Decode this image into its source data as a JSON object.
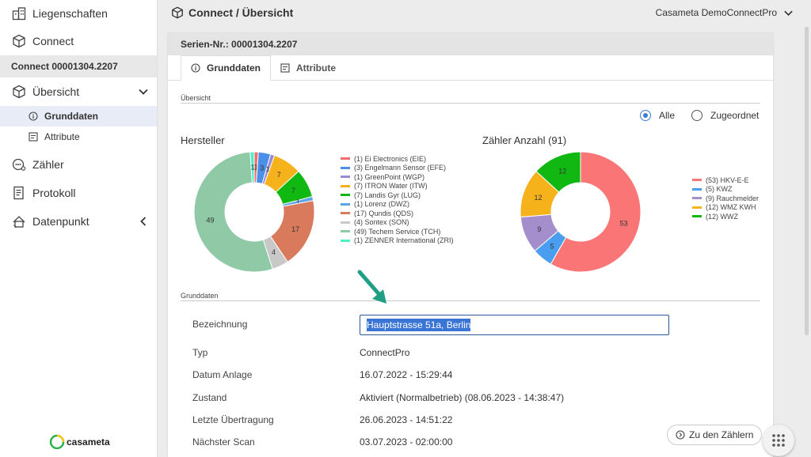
{
  "sidebar": {
    "items": [
      {
        "label": "Liegenschaften",
        "icon": "building-icon"
      },
      {
        "label": "Connect",
        "icon": "cube-icon"
      }
    ],
    "connect_header": "Connect 00001304.2207",
    "uebersicht": "Übersicht",
    "sub_items": [
      {
        "label": "Grunddaten",
        "icon": "info-icon",
        "active": true
      },
      {
        "label": "Attribute",
        "icon": "list-icon",
        "active": false
      }
    ],
    "lower_items": [
      {
        "label": "Zähler",
        "icon": "meter-icon"
      },
      {
        "label": "Protokoll",
        "icon": "document-icon"
      },
      {
        "label": "Datenpunkt",
        "icon": "datapoint-icon"
      }
    ],
    "logo_text": "casameta"
  },
  "header": {
    "title": "Connect / Übersicht",
    "tenant": "Casameta DemoConnectPro"
  },
  "card": {
    "serial": "Serien-Nr.: 00001304.2207",
    "tabs": [
      {
        "label": "Grunddaten",
        "active": true
      },
      {
        "label": "Attribute",
        "active": false
      }
    ],
    "overview_label": "Übersicht",
    "filter": {
      "option1": "Alle",
      "option2": "Zugeordnet",
      "selected": "Alle"
    },
    "grunddaten_label": "Grunddaten",
    "fields": [
      {
        "label": "Bezeichnung",
        "value": "Hauptstrasse 51a, Berlin"
      },
      {
        "label": "Typ",
        "value": "ConnectPro"
      },
      {
        "label": "Datum Anlage",
        "value": "16.07.2022 - 15:29:44"
      },
      {
        "label": "Zustand",
        "value": "Aktiviert (Normalbetrieb) (08.06.2023 - 14:38:47)"
      },
      {
        "label": "Letzte Übertragung",
        "value": "26.06.2023 - 14:51:22"
      },
      {
        "label": "Nächster Scan",
        "value": "03.07.2023 - 02:00:00"
      }
    ],
    "zu_button": "Zu den Zählern"
  },
  "chart_data": [
    {
      "type": "pie",
      "title": "Hersteller",
      "categories": [
        "(1) Ei Electronics (EIE)",
        "(3) Engelmann Sensor (EFE)",
        "(1) GreenPoint (WGP)",
        "(7) ITRON Water (ITW)",
        "(7) Landis Gyr (LUG)",
        "(1) Lorenz (DWZ)",
        "(17) Qundis (QDS)",
        "(4) Sontex (SON)",
        "(49) Techem Service (TCH)",
        "(1) ZENNER International (ZRI)"
      ],
      "values": [
        1,
        3,
        1,
        7,
        7,
        1,
        17,
        4,
        49,
        1
      ],
      "colors": [
        "#f46d6d",
        "#4a90e8",
        "#9b8ad0",
        "#f5b21a",
        "#12b812",
        "#5aa5e8",
        "#d97a5c",
        "#c8c8c8",
        "#8fc9a5",
        "#4ef0c8"
      ],
      "legend": "right"
    },
    {
      "type": "pie",
      "title": "Zähler Anzahl (91)",
      "categories": [
        "(53) HKV-E-E",
        "(5) KWZ",
        "(9) Rauchmelder",
        "(12) WMZ KWH",
        "(12) WWZ"
      ],
      "values": [
        53,
        5,
        9,
        12,
        12
      ],
      "colors": [
        "#fa7676",
        "#4a9ef0",
        "#a48ecc",
        "#f5b21a",
        "#12b812"
      ],
      "legend": "right"
    }
  ]
}
